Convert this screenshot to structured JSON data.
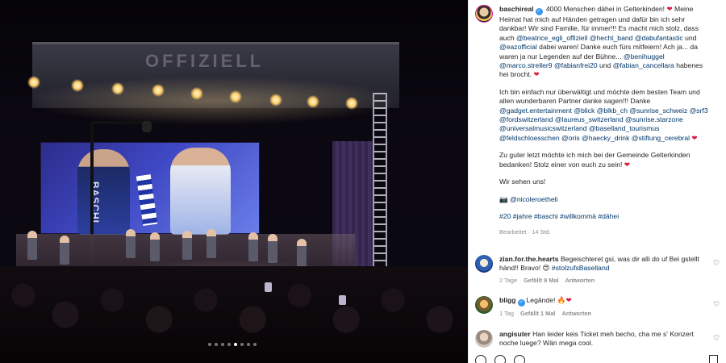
{
  "post": {
    "username": "baschireal",
    "caption_p1": [
      {
        "t": "4000 Menschen dähei in Gelterkinden! "
      },
      {
        "t": "❤",
        "k": "heart"
      },
      {
        "t": " Meine Heimat hat mich auf Händen getragen und dafür bin ich sehr dankbar! Wir sind Familie, für immer!!! Es macht mich stolz, dass auch "
      },
      {
        "t": "@beatrice_egli_offiziell",
        "k": "mention"
      },
      {
        "t": " "
      },
      {
        "t": "@hecht_band",
        "k": "mention"
      },
      {
        "t": " "
      },
      {
        "t": "@dabufantastic",
        "k": "mention"
      },
      {
        "t": " und "
      },
      {
        "t": "@eazofficial",
        "k": "mention"
      },
      {
        "t": " dabei waren! Danke euch fürs mitfeiern! Ach ja... da waren ja nur Legenden auf der Bühne... "
      },
      {
        "t": "@benihuggel",
        "k": "mention"
      },
      {
        "t": " "
      },
      {
        "t": "@marco.streller9",
        "k": "mention"
      },
      {
        "t": " "
      },
      {
        "t": "@fabianfrei20",
        "k": "mention"
      },
      {
        "t": " und "
      },
      {
        "t": "@fabian_cancellara",
        "k": "mention"
      },
      {
        "t": " habenes hei brocht. "
      },
      {
        "t": "❤",
        "k": "heart"
      }
    ],
    "caption_p2": [
      {
        "t": "Ich bin einfach nur überwältigt und möchte dem besten Team und allen wunderbaren Partner danke sagen!!! Danke "
      },
      {
        "t": "@gadget.entertainment",
        "k": "mention"
      },
      {
        "t": " "
      },
      {
        "t": "@blick",
        "k": "mention"
      },
      {
        "t": " "
      },
      {
        "t": "@blkb_ch",
        "k": "mention"
      },
      {
        "t": " "
      },
      {
        "t": "@sunrise_schweiz",
        "k": "mention"
      },
      {
        "t": " "
      },
      {
        "t": "@srf3",
        "k": "mention"
      },
      {
        "t": " "
      },
      {
        "t": "@fordswitzerland",
        "k": "mention"
      },
      {
        "t": " "
      },
      {
        "t": "@laureus_switzerland",
        "k": "mention"
      },
      {
        "t": " "
      },
      {
        "t": "@sunrise.starzone",
        "k": "mention"
      },
      {
        "t": " "
      },
      {
        "t": "@universalmusicswitzerland",
        "k": "mention"
      },
      {
        "t": " "
      },
      {
        "t": "@baselland_tourismus",
        "k": "mention"
      },
      {
        "t": " "
      },
      {
        "t": "@feldschloesschen",
        "k": "mention"
      },
      {
        "t": " "
      },
      {
        "t": "@oris",
        "k": "mention"
      },
      {
        "t": " "
      },
      {
        "t": "@haecky_drink",
        "k": "mention"
      },
      {
        "t": " "
      },
      {
        "t": "@stiftung_cerebral",
        "k": "mention"
      },
      {
        "t": " "
      },
      {
        "t": "❤",
        "k": "heart"
      }
    ],
    "caption_p3": [
      {
        "t": "Zu guter letzt möchte ich mich bei der Gemeinde Gelterkinden bedanken! Stolz einer von euch zu sein! "
      },
      {
        "t": "❤",
        "k": "heart"
      }
    ],
    "caption_p4": [
      {
        "t": "Wir sehen uns!"
      }
    ],
    "caption_p5": [
      {
        "t": "📷 "
      },
      {
        "t": "@nicoleroetheli",
        "k": "mention"
      }
    ],
    "caption_p6": [
      {
        "t": "#20",
        "k": "mention"
      },
      {
        "t": " "
      },
      {
        "t": "#jahre",
        "k": "mention"
      },
      {
        "t": " "
      },
      {
        "t": "#baschi",
        "k": "mention"
      },
      {
        "t": " "
      },
      {
        "t": "#willkommä",
        "k": "mention"
      },
      {
        "t": " "
      },
      {
        "t": "#dähei",
        "k": "mention"
      }
    ],
    "edited_meta": "Bearbeitet · 14 Std."
  },
  "photo": {
    "truss_word": "OFFIZIELL",
    "scarf_word": "BASCHI"
  },
  "comments": [
    {
      "username": "zian.for.the.hearts",
      "verified": false,
      "text": [
        {
          "t": "Begeischteret gsi, was dir alli do uf Bei gstellt händ!! Bravo! 😍 "
        },
        {
          "t": "#stolzufsBaselland",
          "k": "mention"
        }
      ],
      "age": "2 Tage",
      "likes": "Gefällt 9 Mal",
      "reply": "Antworten"
    },
    {
      "username": "bligg",
      "verified": true,
      "text": [
        {
          "t": "Legände! 🔥"
        },
        {
          "t": "❤",
          "k": "heart"
        }
      ],
      "age": "1 Tag",
      "likes": "Gefällt 1 Mal",
      "reply": "Antworten"
    },
    {
      "username": "angisuter",
      "verified": false,
      "text": [
        {
          "t": "Han leider keis Ticket meh becho, cha me s' Konzert noche luege? Wän mega cool."
        }
      ],
      "age": "",
      "likes": "",
      "reply": ""
    }
  ],
  "carousel": {
    "count": 8,
    "active_index": 4
  },
  "colors": {
    "mention": "#00376b",
    "heart": "#d91e45",
    "verified": "#3897f0",
    "meta": "#8e8e8e"
  },
  "icons": {
    "verified": "verified-badge-icon",
    "heart": "heart-icon",
    "like": "like-heart-icon",
    "comment": "comment-icon",
    "share": "share-icon",
    "save": "save-icon"
  }
}
